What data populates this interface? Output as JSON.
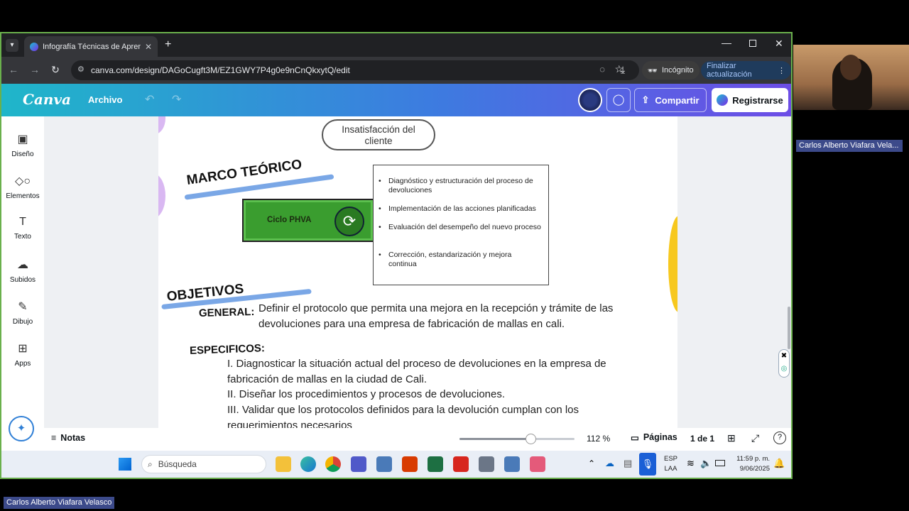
{
  "browser": {
    "tab_title": "Infografía Técnicas de Aprendiz",
    "url": "canva.com/design/DAGoCugft3M/EZ1GWY7P4g0e9nCnQkxytQ/edit",
    "incognito_label": "Incógnito",
    "update_label": "Finalizar actualización"
  },
  "canva": {
    "logo": "Canva",
    "menu_file": "Archivo",
    "share_label": "Compartir",
    "register_label": "Registrarse"
  },
  "sidebar": {
    "items": [
      {
        "label": "Diseño",
        "icon": "layout-icon"
      },
      {
        "label": "Elementos",
        "icon": "shapes-icon"
      },
      {
        "label": "Texto",
        "icon": "text-icon"
      },
      {
        "label": "Subidos",
        "icon": "upload-cloud-icon"
      },
      {
        "label": "Dibujo",
        "icon": "pen-icon"
      },
      {
        "label": "Apps",
        "icon": "apps-icon"
      }
    ]
  },
  "slide": {
    "bubble_text": "Insatisfacción del cliente",
    "marco_title": "MARCO TEÓRICO",
    "cycle_label": "Ciclo PHVA",
    "bullets": [
      "Diagnóstico y estructuración del proceso de devoluciones",
      "Implementación de las acciones planificadas",
      "Evaluación del desempeño del nuevo proceso",
      "Corrección, estandarización y mejora continua"
    ],
    "objetivos_title": "OBJETIVOS",
    "general_label": "GENERAL:",
    "general_text": "Definir el protocolo que permita una mejora en la recepción y trámite de las devoluciones para una empresa de fabricación de mallas en cali.",
    "especificos_label": "ESPECIFICOS:",
    "especificos": [
      "I. Diagnosticar la situación actual del proceso de devoluciones en la empresa de fabricación de mallas en la ciudad de Cali.",
      "II. Diseñar los procedimientos y procesos de devoluciones.",
      "III. Validar que los protocolos definidos para la devolución cumplan con los requerimientos necesarios"
    ]
  },
  "bottom": {
    "notes_label": "Notas",
    "zoom": "112 %",
    "zoom_fraction": 0.62,
    "pages_label": "Páginas",
    "page_count": "1 de 1"
  },
  "taskbar": {
    "search_placeholder": "Búsqueda",
    "lang_top": "ESP",
    "lang_bottom": "LAA",
    "time": "11:59 p. m.",
    "date": "9/06/2025"
  },
  "participant": {
    "name_short": "Carlos Alberto Viafara Vela...",
    "name_full": "Carlos Alberto Viafara Velasco"
  },
  "colors": {
    "frame_green": "#6ab04c",
    "canva_purple": "#7d2ae8",
    "phva_green": "#3a9d2f",
    "highlight_blue": "#7aa7e6",
    "lilac": "#d9b8f2",
    "yellow": "#f7c81e"
  }
}
